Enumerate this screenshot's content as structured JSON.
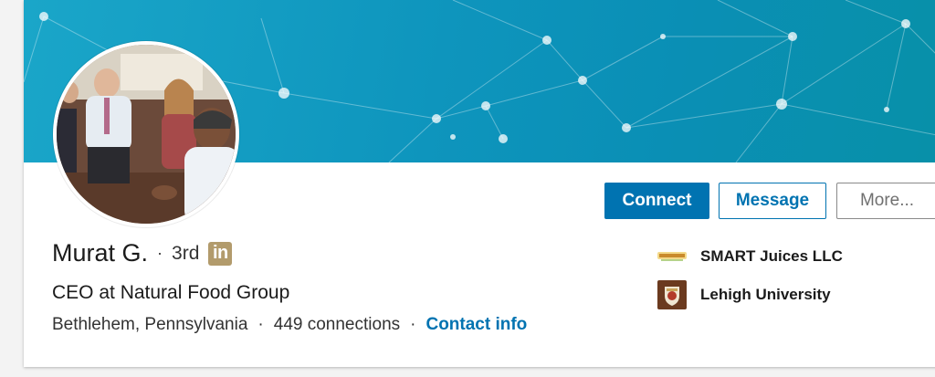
{
  "profile": {
    "name": "Murat G.",
    "separator": "·",
    "degree": "3rd",
    "badge_text": "in",
    "headline": "CEO at Natural Food Group",
    "location": "Bethlehem, Pennsylvania",
    "connections": "449 connections",
    "contact_label": "Contact info"
  },
  "actions": {
    "connect_label": "Connect",
    "message_label": "Message",
    "more_label": "More..."
  },
  "orgs": [
    {
      "name": "SMART Juices LLC",
      "icon": "smart-juices-logo-icon"
    },
    {
      "name": "Lehigh University",
      "icon": "lehigh-university-crest-icon"
    }
  ],
  "colors": {
    "primary": "#0073b1",
    "banner": "#0e95bd",
    "premium_badge": "#b29b6c"
  }
}
